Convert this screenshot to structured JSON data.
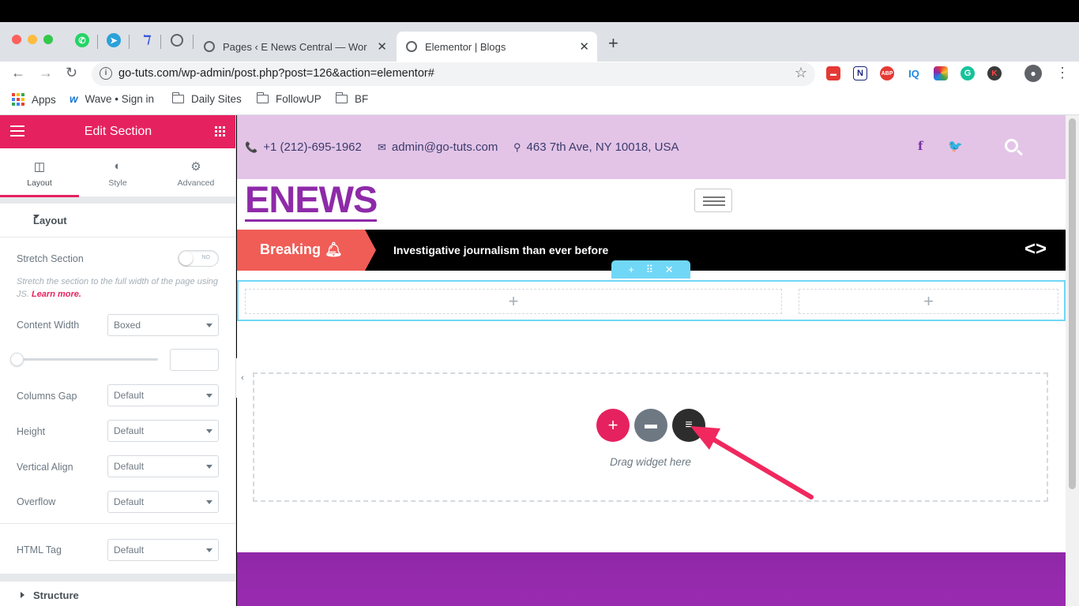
{
  "browser": {
    "tabs": [
      {
        "label": "Pages ‹ E News Central — Wor"
      },
      {
        "label": "Elementor | Blogs"
      }
    ],
    "url": "go-tuts.com/wp-admin/post.php?post=126&action=elementor#",
    "bookmarks": [
      {
        "label": "Apps"
      },
      {
        "label": "Wave • Sign in"
      },
      {
        "label": "Daily Sites"
      },
      {
        "label": "FollowUP"
      },
      {
        "label": "BF"
      }
    ],
    "extensions": [
      "IQ"
    ]
  },
  "panel": {
    "title": "Edit Section",
    "tabs": [
      {
        "label": "Layout"
      },
      {
        "label": "Style"
      },
      {
        "label": "Advanced"
      }
    ],
    "section_title": "Layout",
    "stretch_label": "Stretch Section",
    "stretch_toggle": "NO",
    "stretch_desc": "Stretch the section to the full width of the page using JS.",
    "learn_more": "Learn more.",
    "content_width_label": "Content Width",
    "content_width_value": "Boxed",
    "columns_gap_label": "Columns Gap",
    "columns_gap_value": "Default",
    "height_label": "Height",
    "height_value": "Default",
    "vertical_align_label": "Vertical Align",
    "vertical_align_value": "Default",
    "overflow_label": "Overflow",
    "overflow_value": "Default",
    "html_tag_label": "HTML Tag",
    "html_tag_value": "Default",
    "structure_label": "Structure"
  },
  "site": {
    "phone": "+1 (212)-695-1962",
    "email": "admin@go-tuts.com",
    "address": "463 7th Ave, NY 10018, USA",
    "logo": "ENEWS",
    "breaking_label": "Breaking",
    "breaking_text": "Investigative journalism than ever before",
    "drag_text": "Drag widget here"
  },
  "colors": {
    "elementor_pink": "#e6215f",
    "topbar_lilac": "#e3c4e7",
    "brand_purple": "#8e2aa8",
    "breaking_red": "#f05d56",
    "section_handle": "#71d7f7"
  }
}
